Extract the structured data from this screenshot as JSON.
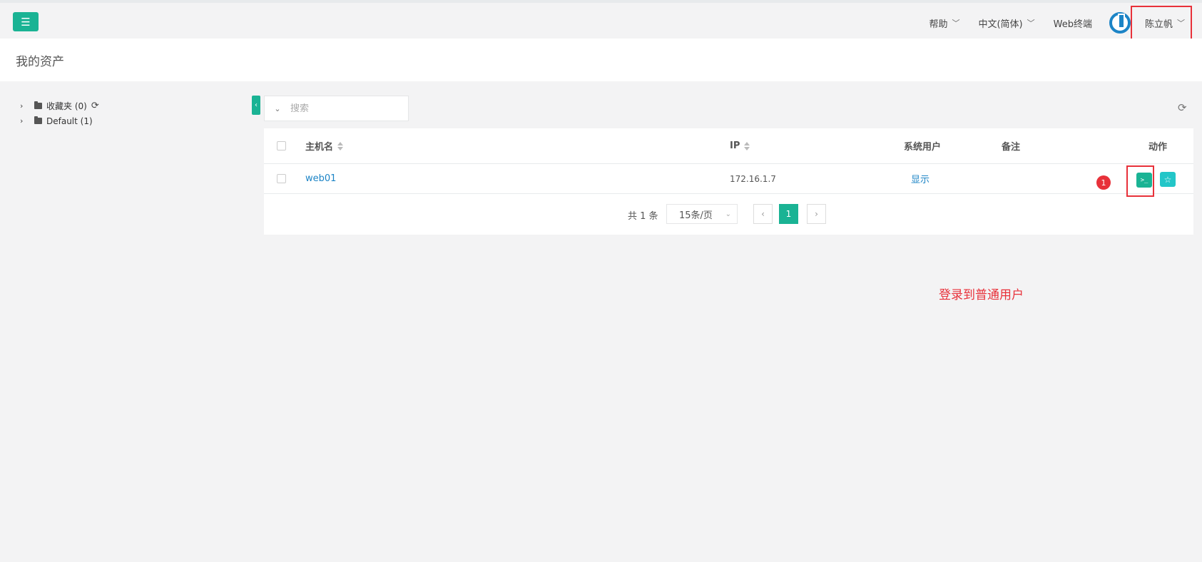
{
  "topbar": {
    "menu_icon": "hamburger-icon",
    "help": "帮助",
    "language": "中文(简体)",
    "web_terminal": "Web终端",
    "user_name": "陈立帆",
    "caret": "﹀"
  },
  "page": {
    "title": "我的资产"
  },
  "tree": {
    "nodes": [
      {
        "label": "收藏夹 (0)"
      },
      {
        "label": "Default (1)"
      }
    ]
  },
  "search": {
    "placeholder": "搜索"
  },
  "table": {
    "columns": {
      "hostname": "主机名",
      "ip": "IP",
      "system_user": "系统用户",
      "comment": "备注",
      "actions": "动作"
    },
    "rows": [
      {
        "hostname": "web01",
        "ip": "172.16.1.7",
        "system_user": "显示",
        "comment": ""
      }
    ],
    "terminal_icon": ">_",
    "star_icon": "☆",
    "step_badge": "1"
  },
  "pagination": {
    "total": "共 1 条",
    "page_size": "15条/页",
    "prev": "‹",
    "current": "1",
    "next": "›"
  },
  "annotation": "登录到普通用户",
  "colors": {
    "primary": "#1ab394",
    "info": "#23c6c8",
    "link": "#1c84c6",
    "highlight": "#e8313a"
  }
}
